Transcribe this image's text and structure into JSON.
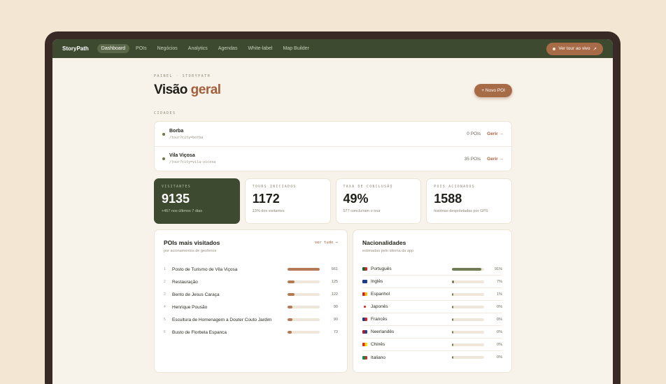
{
  "app": {
    "brand": "StoryPath"
  },
  "nav": [
    {
      "label": "Dashboard",
      "active": true
    },
    {
      "label": "POIs"
    },
    {
      "label": "Negócios"
    },
    {
      "label": "Analytics"
    },
    {
      "label": "Agendas"
    },
    {
      "label": "White-label"
    },
    {
      "label": "Map Builder"
    }
  ],
  "live_button": "Ver tour ao vivo",
  "live_arrow": "↗",
  "breadcrumb": "PAINEL · STORYPATH",
  "title": {
    "main": "Visão",
    "accent": "geral"
  },
  "new_poi": "+ Novo POI",
  "cities_label": "CIDADES",
  "cities": [
    {
      "name": "Borba",
      "path": "/tour?city=borba",
      "pois": "0 POIs",
      "manage": "Gerir →"
    },
    {
      "name": "Vila Viçosa",
      "path": "/tour?city=vila-vicosa",
      "pois": "35 POIs",
      "manage": "Gerir →"
    }
  ],
  "stats": [
    {
      "label": "VISITANTES",
      "value": "9135",
      "sub": "+457 nos últimos 7 dias"
    },
    {
      "label": "TOURS INICIADOS",
      "value": "1172",
      "sub": "13% dos visitantes"
    },
    {
      "label": "TAXA DE CONCLUSÃO",
      "value": "49%",
      "sub": "577 concluíram o tour"
    },
    {
      "label": "POIS ACIONADOS",
      "value": "1588",
      "sub": "histórias despoletadas por GPS"
    }
  ],
  "top_pois": {
    "title": "POIs mais visitados",
    "subtitle": "por acionamentos de geofence",
    "see_all": "ver tudo →",
    "rows": [
      {
        "rank": "1",
        "name": "Posto de Turismo de Vila Viçosa",
        "value": "561",
        "fraction": 1.0
      },
      {
        "rank": "2",
        "name": "Restauração",
        "value": "125",
        "fraction": 0.22
      },
      {
        "rank": "3",
        "name": "Bento de Jesus Caraça",
        "value": "122",
        "fraction": 0.22
      },
      {
        "rank": "4",
        "name": "Henrique Pousão",
        "value": "90",
        "fraction": 0.16
      },
      {
        "rank": "5",
        "name": "Escultura de Homenagem a Douter Couto Jardim",
        "value": "90",
        "fraction": 0.16
      },
      {
        "rank": "6",
        "name": "Busto de Florbela Espanca",
        "value": "73",
        "fraction": 0.13
      }
    ]
  },
  "nationalities": {
    "title": "Nacionalidades",
    "subtitle": "estimadas pelo idioma da app",
    "rows": [
      {
        "name": "Português",
        "value": "91%",
        "fraction": 0.91,
        "flag": "portugal-flag-icon",
        "colors": [
          "#0a6b2d",
          "#d8262b"
        ]
      },
      {
        "name": "Inglês",
        "value": "7%",
        "fraction": 0.07,
        "flag": "uk-flag-icon",
        "colors": [
          "#1f3c88",
          "#d8262b"
        ]
      },
      {
        "name": "Espanhol",
        "value": "1%",
        "fraction": 0.02,
        "flag": "spain-flag-icon",
        "colors": [
          "#c8202a",
          "#f2c200"
        ]
      },
      {
        "name": "Japonês",
        "value": "0%",
        "fraction": 0.01,
        "flag": "japan-flag-icon",
        "colors": [
          "#ffffff",
          "#d8262b"
        ]
      },
      {
        "name": "Francês",
        "value": "0%",
        "fraction": 0.01,
        "flag": "france-flag-icon",
        "colors": [
          "#1f3c88",
          "#d8262b"
        ]
      },
      {
        "name": "Neerlandês",
        "value": "0%",
        "fraction": 0.01,
        "flag": "netherlands-flag-icon",
        "colors": [
          "#ae1c28",
          "#21468b"
        ]
      },
      {
        "name": "Chinês",
        "value": "0%",
        "fraction": 0.01,
        "flag": "china-flag-icon",
        "colors": [
          "#de2910",
          "#ffde00"
        ]
      },
      {
        "name": "Italiano",
        "value": "0%",
        "fraction": 0.01,
        "flag": "italy-flag-icon",
        "colors": [
          "#009246",
          "#ce2b37"
        ]
      }
    ]
  }
}
